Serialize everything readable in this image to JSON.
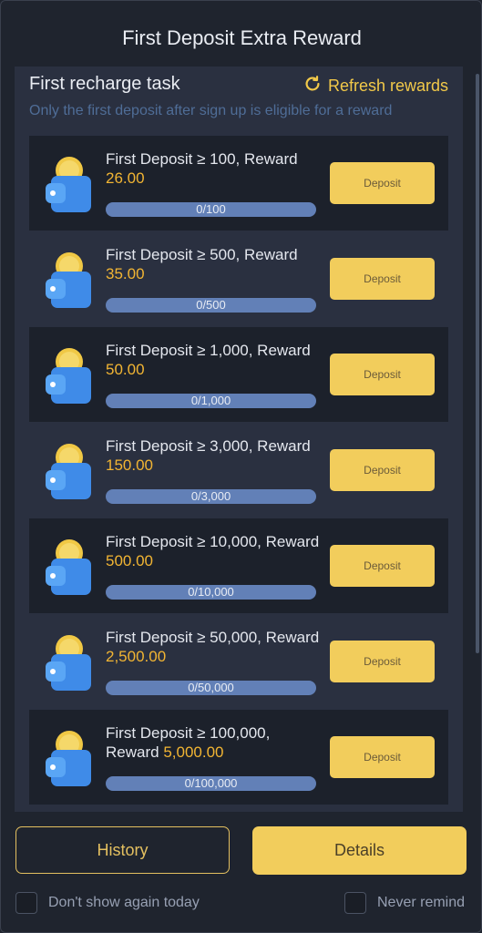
{
  "dialog": {
    "title": "First Deposit Extra Reward"
  },
  "panel": {
    "task_title": "First recharge task",
    "refresh_label": "Refresh rewards",
    "subtitle": "Only the first deposit after sign up is eligible for a reward"
  },
  "tasks": [
    {
      "prefix": "First Deposit ≥ 100, Reward",
      "amount": "26.00",
      "progress": "0/100",
      "button": "Deposit"
    },
    {
      "prefix": "First Deposit ≥ 500, Reward",
      "amount": "35.00",
      "progress": "0/500",
      "button": "Deposit"
    },
    {
      "prefix": "First Deposit ≥ 1,000, Reward",
      "amount": "50.00",
      "progress": "0/1,000",
      "button": "Deposit"
    },
    {
      "prefix": "First Deposit ≥ 3,000, Reward",
      "amount": "150.00",
      "progress": "0/3,000",
      "button": "Deposit"
    },
    {
      "prefix": "First Deposit ≥ 10,000, Reward",
      "amount": "500.00",
      "progress": "0/10,000",
      "button": "Deposit"
    },
    {
      "prefix": "First Deposit ≥ 50,000, Reward",
      "amount": "2,500.00",
      "progress": "0/50,000",
      "button": "Deposit"
    },
    {
      "prefix": "First Deposit ≥ 100,000, Reward",
      "amount": "5,000.00",
      "progress": "0/100,000",
      "button": "Deposit"
    }
  ],
  "footer": {
    "history_label": "History",
    "details_label": "Details",
    "dont_show_label": "Don't show again today",
    "never_remind_label": "Never remind"
  },
  "colors": {
    "accent": "#f2cd5c",
    "reward_amount": "#f2b533",
    "progress_bar": "#6280b7",
    "panel_bg": "#2a3040",
    "dark_row_bg": "#1c212b"
  }
}
